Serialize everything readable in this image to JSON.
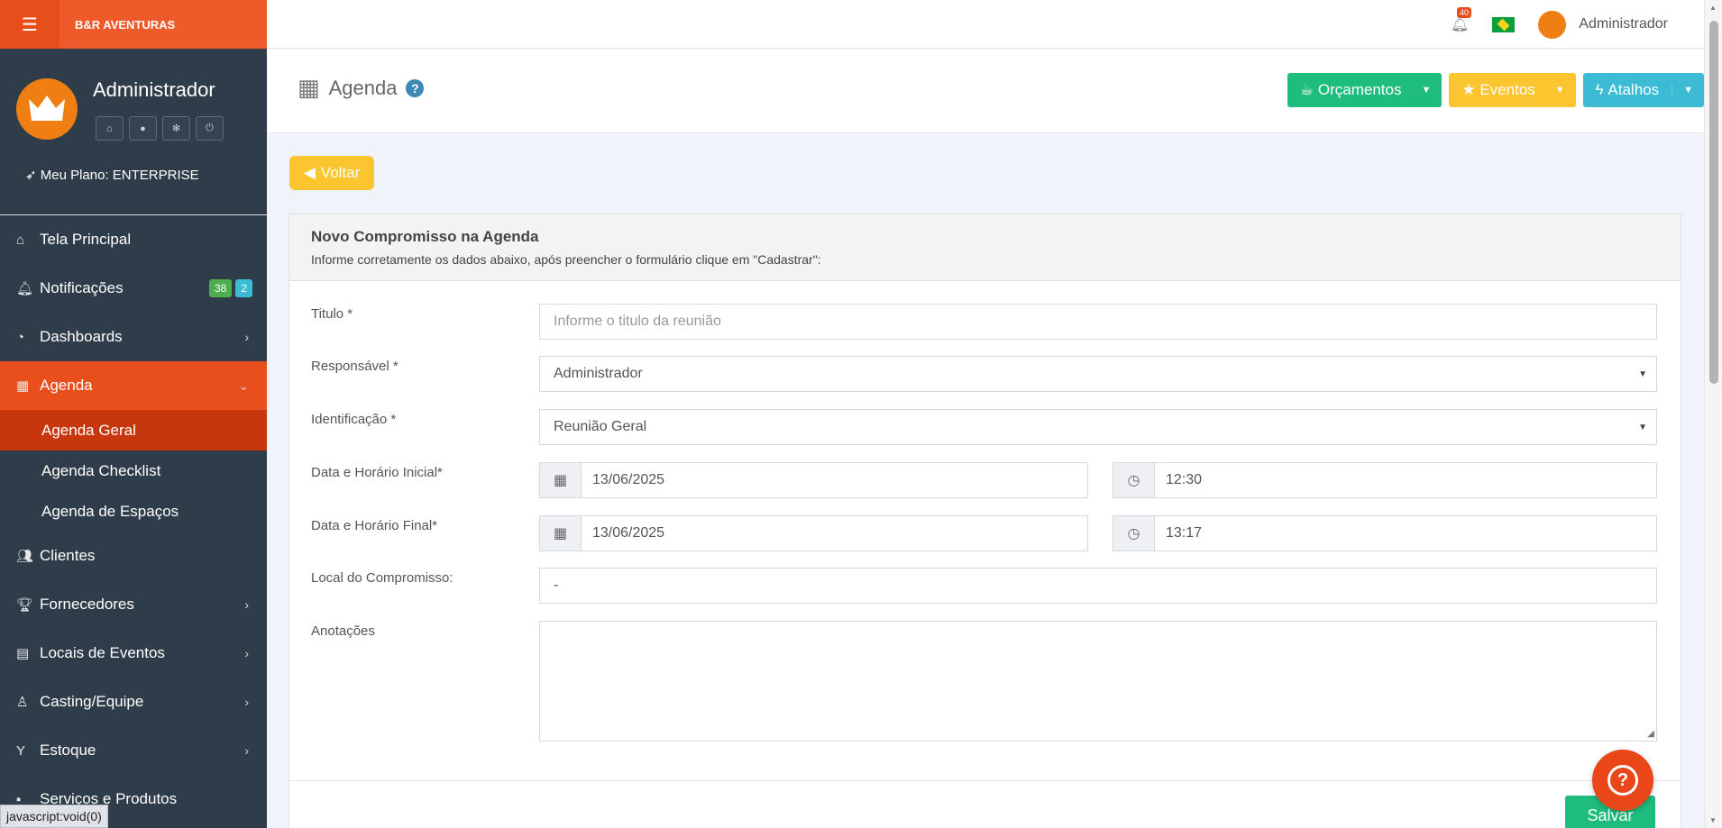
{
  "brand": {
    "name": "B&R AVENTURAS"
  },
  "profile": {
    "name": "Administrador",
    "plan": "Meu Plano: ENTERPRISE"
  },
  "sidebar": {
    "items": [
      {
        "label": "Tela Principal",
        "icon": "home-icon"
      },
      {
        "label": "Notificações",
        "icon": "bell-icon",
        "badge_green": "38",
        "badge_blue": "2"
      },
      {
        "label": "Dashboards",
        "icon": "dashboard-icon"
      },
      {
        "label": "Agenda",
        "icon": "calendar-icon"
      },
      {
        "label": "Clientes",
        "icon": "users-icon"
      },
      {
        "label": "Fornecedores",
        "icon": "trophy-icon"
      },
      {
        "label": "Locais de Eventos",
        "icon": "building-icon"
      },
      {
        "label": "Casting/Equipe",
        "icon": "person-icon"
      },
      {
        "label": "Estoque",
        "icon": "glass-icon"
      },
      {
        "label": "Serviços e Produtos",
        "icon": "box-icon"
      }
    ],
    "subitems": [
      "Agenda Geral",
      "Agenda Checklist",
      "Agenda de Espaços"
    ]
  },
  "topbar": {
    "notification_count": "40",
    "user": "Administrador"
  },
  "page": {
    "title": "Agenda",
    "buttons": {
      "orcamentos": "Orçamentos",
      "eventos": "Eventos",
      "atalhos": "Atalhos"
    },
    "voltar": "Voltar"
  },
  "form": {
    "heading": "Novo Compromisso na Agenda",
    "subheading": "Informe corretamente os dados abaixo, após preencher o formulário clique em \"Cadastrar\":",
    "titulo": {
      "label": "Titulo *",
      "placeholder": "Informe o titulo da reunião"
    },
    "responsavel": {
      "label": "Responsável *",
      "value": "Administrador"
    },
    "identificacao": {
      "label": "Identificação *",
      "value": "Reunião Geral"
    },
    "inicial": {
      "label": "Data e Horário Inicial*",
      "date": "13/06/2025",
      "time": "12:30"
    },
    "final": {
      "label": "Data e Horário Final*",
      "date": "13/06/2025",
      "time": "13:17"
    },
    "local": {
      "label": "Local do Compromisso:",
      "value": "-"
    },
    "anotacoes": {
      "label": "Anotações"
    },
    "salvar": "Salvar"
  },
  "status_bar": "javascript:void(0)",
  "colors": {
    "accent": "#e84f1d",
    "sidebar": "#2f3d4a",
    "green": "#1ebc7d",
    "yellow": "#fbc530",
    "blue": "#3cbbd5"
  }
}
